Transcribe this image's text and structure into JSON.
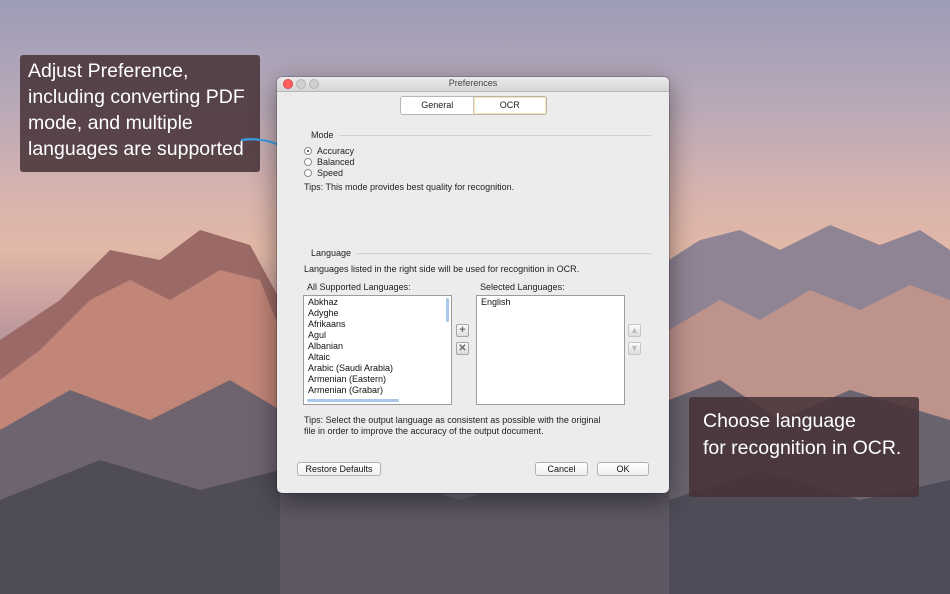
{
  "callouts": {
    "left": [
      "Adjust Preference,",
      "including converting PDF",
      "mode, and multiple",
      "languages are supported"
    ],
    "right": [
      "Choose language",
      " for recognition in OCR."
    ]
  },
  "window": {
    "title": "Preferences",
    "tabs": [
      {
        "label": "General",
        "selected": false
      },
      {
        "label": "OCR",
        "selected": true
      }
    ],
    "mode": {
      "title": "Mode",
      "options": [
        {
          "label": "Accuracy",
          "checked": true
        },
        {
          "label": "Balanced",
          "checked": false
        },
        {
          "label": "Speed",
          "checked": false
        }
      ],
      "tips": "Tips:  This mode provides best quality for recognition."
    },
    "language": {
      "title": "Language",
      "description": "Languages listed in the right side will be used for recognition in OCR.",
      "all_label": "All Supported Languages:",
      "selected_label": "Selected Languages:",
      "all_languages": [
        "Abkhaz",
        "Adyghe",
        "Afrikaans",
        "Agul",
        "Albanian",
        "Altaic",
        "Arabic (Saudi Arabia)",
        "Armenian (Eastern)",
        "Armenian (Grabar)"
      ],
      "selected_languages": [
        "English"
      ],
      "tips_line1": "Tips:  Select the output language as consistent as possible with the original",
      "tips_line2": "file in order to improve the accuracy of the output document.",
      "add_icon": "plus-icon",
      "remove_icon": "x-icon",
      "up_icon": "arrow-up-icon",
      "down_icon": "arrow-down-icon"
    },
    "buttons": {
      "restore": "Restore Defaults",
      "cancel": "Cancel",
      "ok": "OK"
    }
  }
}
